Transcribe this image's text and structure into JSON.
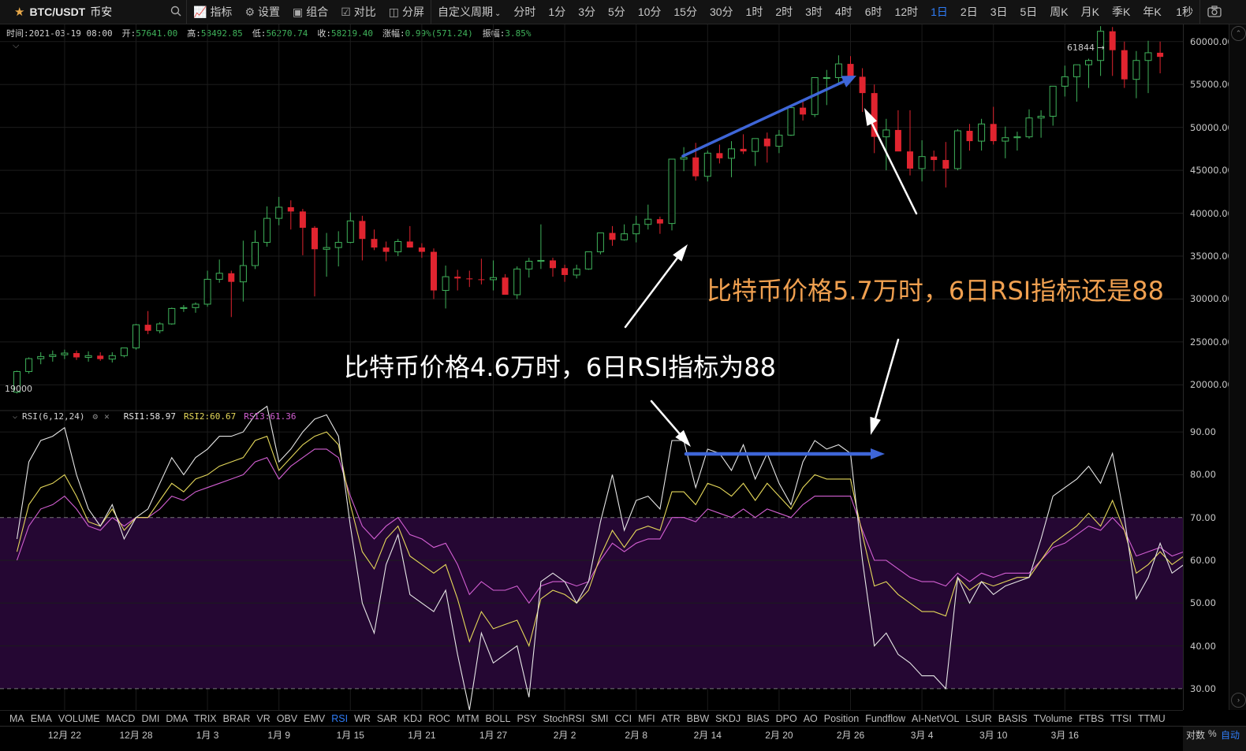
{
  "toolbar": {
    "symbol": "BTC/USDT",
    "exchange": "币安",
    "buttons": [
      {
        "label": "指标",
        "icon": "indicator-icon"
      },
      {
        "label": "设置",
        "icon": "gear-icon"
      },
      {
        "label": "组合",
        "icon": "combo-icon"
      },
      {
        "label": "对比",
        "icon": "compare-icon"
      },
      {
        "label": "分屏",
        "icon": "split-screen-icon"
      }
    ],
    "custom_period": "自定义周期",
    "periods": [
      "分时",
      "1分",
      "3分",
      "5分",
      "10分",
      "15分",
      "30分",
      "1时",
      "2时",
      "3时",
      "4时",
      "6时",
      "12时",
      "1日",
      "2日",
      "3日",
      "5日",
      "周K",
      "月K",
      "季K",
      "年K"
    ],
    "active_period": "1日",
    "sec_label": "1秒"
  },
  "infobar": [
    {
      "label": "时间:",
      "value": "2021-03-19 08:00",
      "neutral": true
    },
    {
      "label": "开:",
      "value": "57641.00"
    },
    {
      "label": "高:",
      "value": "58492.85"
    },
    {
      "label": "低:",
      "value": "56270.74"
    },
    {
      "label": "收:",
      "value": "58219.40"
    },
    {
      "label": "涨幅:",
      "value": "0.99%(571.24)"
    },
    {
      "label": "振幅:",
      "value": "3.85%"
    }
  ],
  "rsi_legend": {
    "name": "RSI(6,12,24)",
    "rsi1": "RSI1:58.97",
    "rsi2": "RSI2:60.67",
    "rsi3": "RSI3:61.36"
  },
  "price_axis": [
    "60000.00",
    "55000.00",
    "50000.00",
    "45000.00",
    "40000.00",
    "35000.00",
    "30000.00",
    "25000.00",
    "20000.00"
  ],
  "rsi_axis": [
    "90.00",
    "80.00",
    "70.00",
    "60.00",
    "50.00",
    "40.00",
    "30.00"
  ],
  "price_marks": {
    "high": "61844",
    "low": "19000"
  },
  "annotations": {
    "top_right": "比特币价格5.7万时，6日RSI指标还是88",
    "middle": "比特币价格4.6万时，6日RSI指标为88"
  },
  "indicator_tabs": [
    "MA",
    "EMA",
    "VOLUME",
    "MACD",
    "DMI",
    "DMA",
    "TRIX",
    "BRAR",
    "VR",
    "OBV",
    "EMV",
    "RSI",
    "WR",
    "SAR",
    "KDJ",
    "ROC",
    "MTM",
    "BOLL",
    "PSY",
    "StochRSI",
    "SMI",
    "CCI",
    "MFI",
    "ATR",
    "BBW",
    "SKDJ",
    "BIAS",
    "DPO",
    "AO",
    "Position",
    "Fundflow",
    "AI-NetVOL",
    "LSUR",
    "BASIS",
    "TVolume",
    "FTBS",
    "TTSI",
    "TTMU"
  ],
  "active_indicator": "RSI",
  "date_axis": [
    "12月 22",
    "12月 28",
    "1月 3",
    "1月 9",
    "1月 15",
    "1月 21",
    "1月 27",
    "2月 2",
    "2月 8",
    "2月 14",
    "2月 20",
    "2月 26",
    "3月 4",
    "3月 10",
    "3月 16"
  ],
  "axis_controls": {
    "log": "对数",
    "percent": "%",
    "auto": "自动"
  },
  "colors": {
    "up": "#3fb15a",
    "down": "#e0242f",
    "rsi1": "#e6e6e6",
    "rsi2": "#e5d85a",
    "rsi3": "#d35fd3",
    "accent": "#2f7cf6",
    "annotation_orange": "#f0a050",
    "arrow_blue": "#3e66d8"
  },
  "chart_data": [
    {
      "type": "candlestick",
      "title": "BTC/USDT 1日",
      "x_start": "2020-12-18",
      "x_step_days": 1,
      "y_range": [
        17000,
        62000
      ],
      "ohlc": [
        [
          19150,
          21650,
          19000,
          21550
        ],
        [
          21550,
          23200,
          21300,
          23050
        ],
        [
          23050,
          23800,
          22400,
          23300
        ],
        [
          23300,
          24000,
          22700,
          23500
        ],
        [
          23500,
          24100,
          23000,
          23700
        ],
        [
          23700,
          24000,
          22900,
          23200
        ],
        [
          23200,
          23900,
          22700,
          23400
        ],
        [
          23400,
          23800,
          22800,
          23000
        ],
        [
          23000,
          23800,
          22600,
          23400
        ],
        [
          23400,
          24200,
          23200,
          24300
        ],
        [
          24300,
          27100,
          24100,
          27000
        ],
        [
          27000,
          28600,
          25900,
          26300
        ],
        [
          26300,
          27300,
          26000,
          27100
        ],
        [
          27100,
          29000,
          27000,
          28900
        ],
        [
          28900,
          29300,
          28500,
          29000
        ],
        [
          29000,
          29600,
          28400,
          29400
        ],
        [
          29400,
          33300,
          29100,
          32300
        ],
        [
          32300,
          34600,
          31900,
          33000
        ],
        [
          33000,
          33300,
          27900,
          32000
        ],
        [
          32000,
          36800,
          29700,
          33900
        ],
        [
          33900,
          38000,
          33500,
          36600
        ],
        [
          36600,
          40800,
          36100,
          39400
        ],
        [
          39400,
          41900,
          38600,
          40700
        ],
        [
          40700,
          41500,
          38100,
          40200
        ],
        [
          40200,
          40500,
          35100,
          38300
        ],
        [
          38300,
          38500,
          30300,
          35800
        ],
        [
          35800,
          37700,
          32600,
          36000
        ],
        [
          36000,
          37900,
          33800,
          36600
        ],
        [
          36600,
          40100,
          36500,
          39100
        ],
        [
          39100,
          39700,
          34500,
          37000
        ],
        [
          37000,
          38100,
          35700,
          36000
        ],
        [
          36000,
          36700,
          34400,
          35500
        ],
        [
          35500,
          37000,
          35000,
          36700
        ],
        [
          36700,
          38500,
          36000,
          36000
        ],
        [
          36000,
          36500,
          34800,
          35500
        ],
        [
          35500,
          35900,
          30000,
          31000
        ],
        [
          31000,
          33900,
          28900,
          32600
        ],
        [
          32600,
          33400,
          31000,
          32400
        ],
        [
          32400,
          33300,
          31400,
          32300
        ],
        [
          32300,
          34700,
          31700,
          32250
        ],
        [
          32250,
          34500,
          31000,
          32500
        ],
        [
          32500,
          32900,
          30800,
          30500
        ],
        [
          30500,
          33800,
          30000,
          33500
        ],
        [
          33500,
          34800,
          32500,
          34400
        ],
        [
          34400,
          38700,
          33500,
          34500
        ],
        [
          34500,
          34800,
          32600,
          33600
        ],
        [
          33600,
          34000,
          32000,
          32800
        ],
        [
          32800,
          34000,
          32400,
          33500
        ],
        [
          33500,
          35500,
          33400,
          35500
        ],
        [
          35500,
          37700,
          35200,
          37700
        ],
        [
          37700,
          38500,
          36200,
          36900
        ],
        [
          36900,
          38700,
          36800,
          37600
        ],
        [
          37600,
          39700,
          36600,
          38700
        ],
        [
          38700,
          41000,
          38100,
          39300
        ],
        [
          39300,
          39600,
          37600,
          38800
        ],
        [
          38800,
          46300,
          38000,
          46300
        ],
        [
          46300,
          47700,
          44900,
          46500
        ],
        [
          46500,
          48200,
          43800,
          44300
        ],
        [
          44300,
          47300,
          43700,
          47000
        ],
        [
          47000,
          48000,
          45800,
          46400
        ],
        [
          46400,
          48400,
          44200,
          47500
        ],
        [
          47500,
          49200,
          46900,
          47200
        ],
        [
          47200,
          48700,
          45500,
          48700
        ],
        [
          48700,
          49400,
          45900,
          47800
        ],
        [
          47800,
          49700,
          47000,
          49100
        ],
        [
          49100,
          51000,
          49000,
          52300
        ],
        [
          52300,
          53000,
          50800,
          51500
        ],
        [
          51500,
          53300,
          51200,
          55800
        ],
        [
          55800,
          56700,
          52600,
          55800
        ],
        [
          55800,
          58400,
          55000,
          57400
        ],
        [
          57400,
          58300,
          56000,
          55900
        ],
        [
          55900,
          56900,
          51800,
          54000
        ],
        [
          54000,
          55000,
          47000,
          48900
        ],
        [
          48900,
          51000,
          45000,
          49700
        ],
        [
          49700,
          52000,
          48000,
          47200
        ],
        [
          47200,
          52000,
          44400,
          45200
        ],
        [
          45200,
          48500,
          43700,
          46600
        ],
        [
          46600,
          47300,
          44900,
          46200
        ],
        [
          46200,
          48300,
          43000,
          45200
        ],
        [
          45200,
          49800,
          45000,
          49600
        ],
        [
          49600,
          50400,
          47300,
          48400
        ],
        [
          48400,
          51000,
          47300,
          50400
        ],
        [
          50400,
          52400,
          48000,
          48400
        ],
        [
          48400,
          50100,
          46400,
          48800
        ],
        [
          48800,
          49500,
          47300,
          48900
        ],
        [
          48900,
          52100,
          48700,
          51100
        ],
        [
          51100,
          52000,
          48800,
          51300
        ],
        [
          51300,
          52900,
          50200,
          54800
        ],
        [
          54800,
          57200,
          53600,
          55900
        ],
        [
          55900,
          57300,
          53000,
          57300
        ],
        [
          57300,
          58000,
          54600,
          57800
        ],
        [
          57800,
          61800,
          56000,
          61200
        ],
        [
          61200,
          61700,
          56000,
          59000
        ],
        [
          59000,
          60000,
          54600,
          55600
        ],
        [
          55600,
          58900,
          53400,
          57800
        ],
        [
          57800,
          60100,
          54000,
          58700
        ],
        [
          58700,
          60000,
          56300,
          58220
        ]
      ]
    },
    {
      "type": "line",
      "title": "RSI(6,12,24)",
      "y_range": [
        25,
        95
      ],
      "bands": [
        30,
        70
      ],
      "series": [
        {
          "name": "RSI1",
          "color": "#e6e6e6",
          "values": [
            65,
            83,
            88,
            89,
            91,
            80,
            72,
            68,
            73,
            65,
            70,
            72,
            78,
            84,
            80,
            84,
            86,
            89,
            89,
            90,
            94,
            96,
            83,
            86,
            90,
            93,
            94,
            89,
            68,
            50,
            43,
            59,
            66,
            52,
            50,
            48,
            53,
            38,
            25,
            43,
            36,
            38,
            40,
            28,
            55,
            57,
            55,
            50,
            55,
            69,
            80,
            67,
            74,
            75,
            72,
            88,
            88,
            77,
            86,
            85,
            81,
            87,
            79,
            85,
            78,
            73,
            83,
            88,
            86,
            87,
            85,
            60,
            40,
            43,
            38,
            36,
            33,
            33,
            30,
            56,
            50,
            55,
            52,
            54,
            55,
            56,
            65,
            75,
            77,
            79,
            82,
            78,
            85,
            70,
            51,
            56,
            64,
            57,
            59
          ]
        },
        {
          "name": "RSI2",
          "color": "#e5d85a",
          "values": [
            62,
            73,
            77,
            78,
            80,
            75,
            69,
            68,
            72,
            67,
            70,
            70,
            74,
            78,
            76,
            79,
            80,
            82,
            83,
            84,
            88,
            89,
            81,
            84,
            87,
            89,
            90,
            87,
            73,
            62,
            58,
            65,
            68,
            61,
            59,
            57,
            59,
            51,
            41,
            48,
            44,
            45,
            46,
            40,
            51,
            53,
            52,
            50,
            53,
            61,
            67,
            63,
            67,
            68,
            67,
            76,
            76,
            73,
            78,
            77,
            75,
            78,
            74,
            78,
            75,
            72,
            77,
            80,
            79,
            79,
            79,
            66,
            54,
            55,
            52,
            50,
            48,
            48,
            47,
            56,
            53,
            55,
            54,
            55,
            56,
            56,
            60,
            64,
            66,
            68,
            71,
            68,
            74,
            67,
            57,
            59,
            62,
            59,
            61
          ]
        },
        {
          "name": "RSI3",
          "color": "#d35fd3",
          "values": [
            60,
            68,
            72,
            73,
            75,
            72,
            68,
            67,
            70,
            68,
            70,
            70,
            72,
            75,
            74,
            76,
            77,
            78,
            79,
            80,
            83,
            84,
            79,
            82,
            84,
            86,
            86,
            84,
            75,
            68,
            65,
            68,
            70,
            66,
            65,
            63,
            64,
            59,
            52,
            55,
            53,
            53,
            54,
            50,
            54,
            55,
            55,
            54,
            55,
            60,
            64,
            62,
            64,
            65,
            65,
            70,
            70,
            69,
            72,
            71,
            70,
            72,
            70,
            72,
            71,
            70,
            73,
            75,
            75,
            75,
            75,
            67,
            60,
            60,
            58,
            56,
            55,
            55,
            54,
            57,
            55,
            57,
            56,
            57,
            57,
            57,
            60,
            63,
            64,
            66,
            68,
            67,
            70,
            67,
            61,
            62,
            63,
            61,
            62
          ]
        }
      ]
    }
  ]
}
